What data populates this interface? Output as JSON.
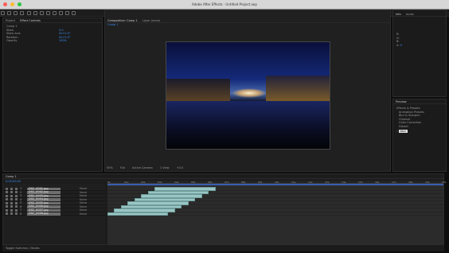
{
  "window": {
    "title": "Adobe After Effects - Untitled Project.aep"
  },
  "toolbar": {
    "workspaces": [
      "Default",
      "Standard",
      "Small Screen",
      "Libraries"
    ],
    "search_placeholder": "Search Help"
  },
  "project_panel": {
    "tabs": [
      "Project",
      "Effect Controls"
    ],
    "rows": [
      {
        "label": "Comp 1",
        "value": ""
      },
      {
        "label": "Skew",
        "value": "0.0"
      },
      {
        "label": "Skew Axis",
        "value": "0x+0.0°"
      },
      {
        "label": "Rotation",
        "value": "0x+0.0°"
      },
      {
        "label": "Opacity",
        "value": "100%"
      }
    ]
  },
  "composition_panel": {
    "tabs": [
      "Composition: Comp 1",
      "Layer (none)"
    ],
    "breadcrumb": "Comp 1",
    "controls": [
      "50%",
      "Full",
      "Active Camera",
      "1 View",
      "+0.0"
    ]
  },
  "right_panels": {
    "info_tabs": [
      "Info",
      "Audio"
    ],
    "info_rows": [
      {
        "label": "R:",
        "value": ""
      },
      {
        "label": "G:",
        "value": ""
      },
      {
        "label": "B:",
        "value": ""
      },
      {
        "label": "A:",
        "value": "0"
      }
    ],
    "preview_tab": "Preview",
    "preview_rows": [
      "Effects & Presets",
      "Animation Presets",
      "Blur & Sharpen",
      "Channel",
      "Color Correction",
      "Distort"
    ],
    "search_value": "blur"
  },
  "timeline": {
    "tab": "Comp 1",
    "timecode": "0;00;00;00",
    "columns": [
      "#",
      "Source Name",
      "Parent"
    ],
    "ruler": [
      "0s",
      "01s",
      "02s",
      "03s",
      "04s",
      "05s",
      "06s",
      "07s",
      "08s",
      "09s",
      "10s",
      "11s",
      "12s",
      "13s",
      "14s",
      "15s",
      "16s",
      "17s",
      "18s",
      "19s",
      "20s"
    ],
    "layers": [
      {
        "num": "1",
        "name": "DSC_0001.jpg",
        "parent": "None",
        "start": 0.14,
        "end": 0.32
      },
      {
        "num": "2",
        "name": "DSC_0002.jpg",
        "parent": "None",
        "start": 0.12,
        "end": 0.3
      },
      {
        "num": "3",
        "name": "DSC_0003.jpg",
        "parent": "None",
        "start": 0.1,
        "end": 0.28
      },
      {
        "num": "4",
        "name": "DSC_0004.jpg",
        "parent": "None",
        "start": 0.08,
        "end": 0.26
      },
      {
        "num": "5",
        "name": "DSC_0005.jpg",
        "parent": "None",
        "start": 0.06,
        "end": 0.24
      },
      {
        "num": "6",
        "name": "DSC_0006.jpg",
        "parent": "None",
        "start": 0.04,
        "end": 0.22
      },
      {
        "num": "7",
        "name": "DSC_0007.jpg",
        "parent": "None",
        "start": 0.02,
        "end": 0.2
      },
      {
        "num": "8",
        "name": "DSC_0008.jpg",
        "parent": "None",
        "start": 0.0,
        "end": 0.18
      }
    ]
  },
  "status": {
    "left": "Toggle Switches / Modes"
  },
  "colors": {
    "accent": "#3b8df1",
    "layer_bar": "#9ac7c5",
    "panel": "#1b1b1b"
  }
}
